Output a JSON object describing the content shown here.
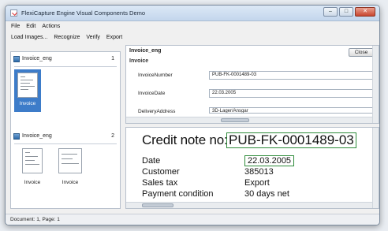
{
  "window": {
    "title": "FlexiCapture Engine Visual Components Demo"
  },
  "window_buttons": {
    "minimize": "–",
    "maximize": "□",
    "close": "✕"
  },
  "menu": [
    "File",
    "Edit",
    "Actions"
  ],
  "toolbar": [
    "Load Images...",
    "Recognize",
    "Verify",
    "Export"
  ],
  "documents": [
    {
      "name": "Invoice_eng",
      "number": "1",
      "pages": [
        "Invoice"
      ]
    },
    {
      "name": "Invoice_eng",
      "number": "2",
      "pages": [
        "Invoice",
        "Invoice"
      ]
    }
  ],
  "form": {
    "title": "Invoice_eng",
    "close_label": "Close",
    "section": "Invoice",
    "fields": [
      {
        "label": "InvoiceNumber",
        "value": "PUB-FK-0001489-03"
      },
      {
        "label": "InvoiceDate",
        "value": "22.03.2005"
      },
      {
        "label": "DeliveryAddress",
        "value": "3D-Lager/Ansgar"
      }
    ]
  },
  "image": {
    "credit_prefix": "Credit note no:",
    "credit_number": "PUB-FK-0001489-03",
    "rows": [
      {
        "label": "Date",
        "value": "22.03.2005"
      },
      {
        "label": "Customer",
        "value": "385013"
      },
      {
        "label": "Sales tax",
        "value": "Export"
      },
      {
        "label": "Payment condition",
        "value": "30 days net"
      }
    ]
  },
  "status": "Document: 1, Page: 1",
  "colors": {
    "selection": "#3d7cc9",
    "highlight_box": "#2e8b3a"
  }
}
